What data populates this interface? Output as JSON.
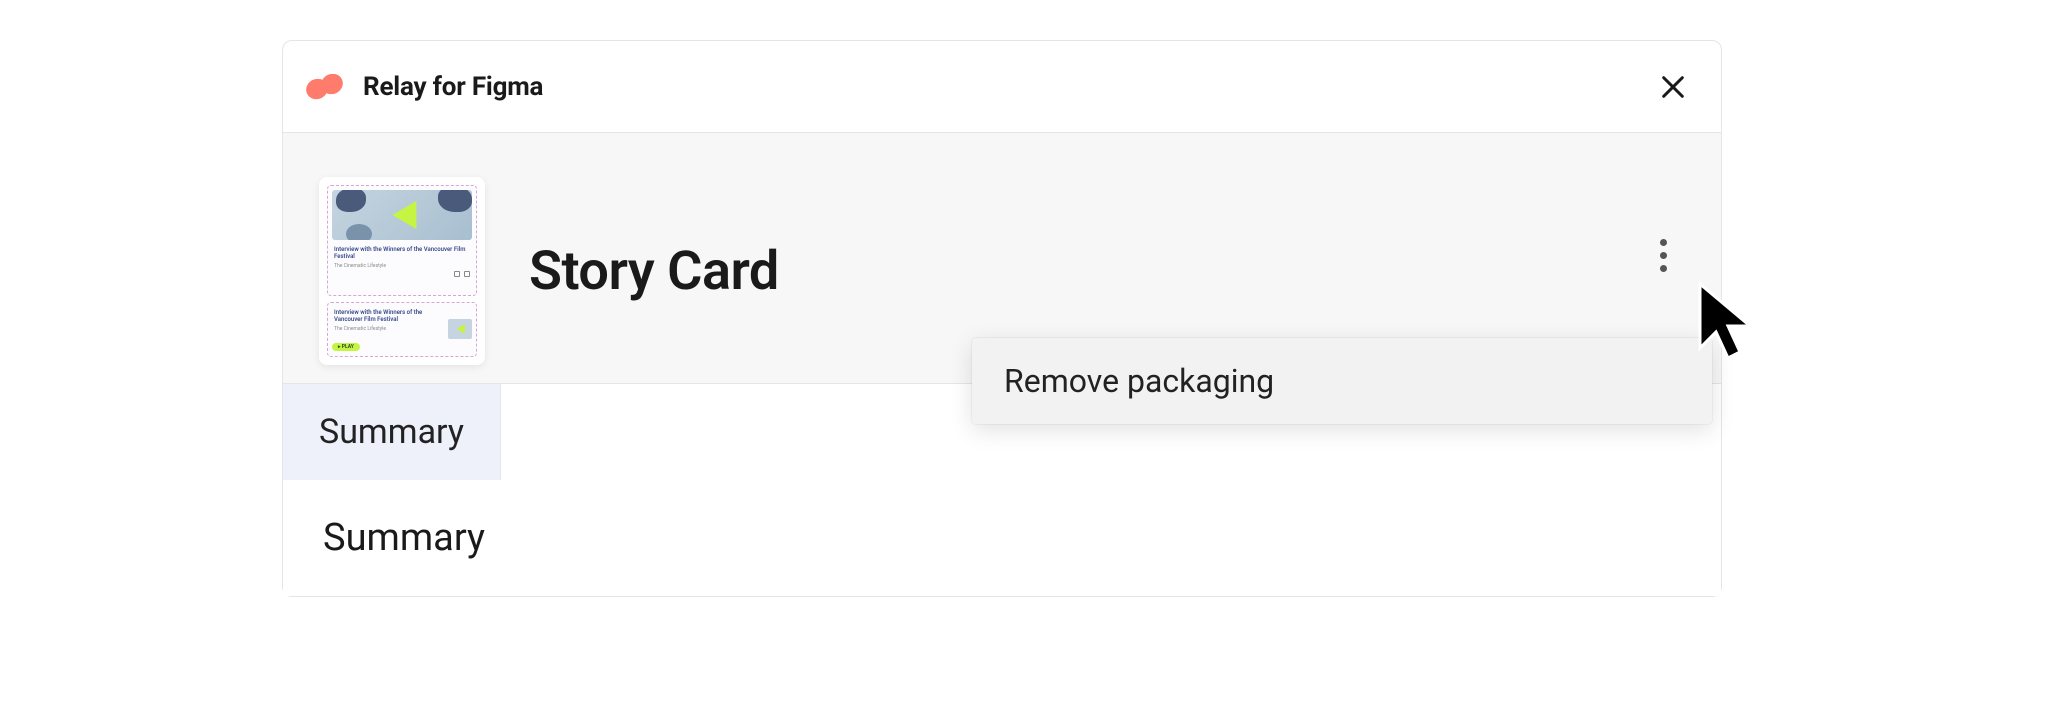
{
  "header": {
    "app_title": "Relay for Figma"
  },
  "component": {
    "title": "Story Card"
  },
  "thumbnail": {
    "card1_title": "Interview with the Winners of the Vancouver Film Festival",
    "card1_sub": "The Cinematic Lifestyle",
    "card2_title": "Interview with the Winners of the Vancouver Film Festival",
    "card2_sub": "The Cinematic Lifestyle",
    "pill_label": "▸ PLAY"
  },
  "menu": {
    "items": [
      {
        "label": "Remove packaging"
      }
    ]
  },
  "tabs": {
    "items": [
      {
        "label": "Summary",
        "active": true
      }
    ]
  },
  "content": {
    "heading": "Summary"
  }
}
